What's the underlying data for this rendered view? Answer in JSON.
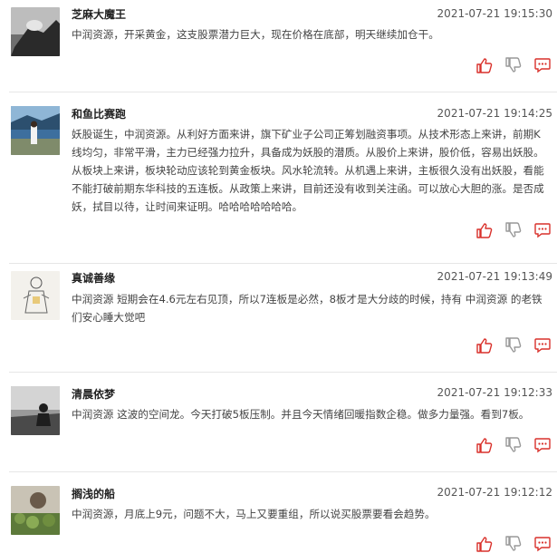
{
  "posts": [
    {
      "username": "芝麻大魔王",
      "time": "2021-07-21 19:15:30",
      "stock": "中润资源",
      "text": "，开采黄金，这支股票潜力巨大，现在价格在底部，明天继续加仓干。"
    },
    {
      "username": "和鱼比赛跑",
      "time": "2021-07-21 19:14:25",
      "text_a": "妖股诞生，",
      "stock": "中润资源",
      "text_b": "。从利好方面来讲，旗下矿业子公司正筹划融资事项。从技术形态上来讲，前期K线均匀，非常平滑，主力已经强力拉升，具备成为妖股的潜质。从股价上来讲，股价低，容易出妖股。从板块上来讲，板块轮动应该轮到黄金板块。风水轮流转。从机遇上来讲，主板很久没有出妖股，看能不能打破前期",
      "stock2": "东华科技",
      "text_c": "的五连板。从政策上来讲，目前还没有收到关注函。可以放心大胆的涨。是否成妖，拭目以待，让时间来证明。哈哈哈哈哈哈哈。"
    },
    {
      "username": "真诚善缘",
      "time": "2021-07-21 19:13:49",
      "stock": "中润资源",
      "text_a": "短期会在4.6元左右见顶，所以7连板是必然，8板才是大分歧的时候，持有",
      "stock2": "中润资源",
      "text_b": "的老铁们安心睡大觉吧"
    },
    {
      "username": "清晨依梦",
      "time": "2021-07-21 19:12:33",
      "stock": "中润资源",
      "text": "这波的空间龙。今天打破5板压制。并且今天情绪回暖指数企稳。做多力量强。看到7板。"
    },
    {
      "username": "搁浅的船",
      "time": "2021-07-21 19:12:12",
      "stock": "中润资源",
      "text": "，月底上9元，问题不大，马上又要重组，所以说买股票要看会趋势。"
    }
  ],
  "icons": {
    "like": "thumbs-up-icon",
    "dislike": "thumbs-down-icon",
    "comment": "comment-icon"
  },
  "colors": {
    "icon_red": "#d9312b",
    "icon_gray": "#999999"
  }
}
